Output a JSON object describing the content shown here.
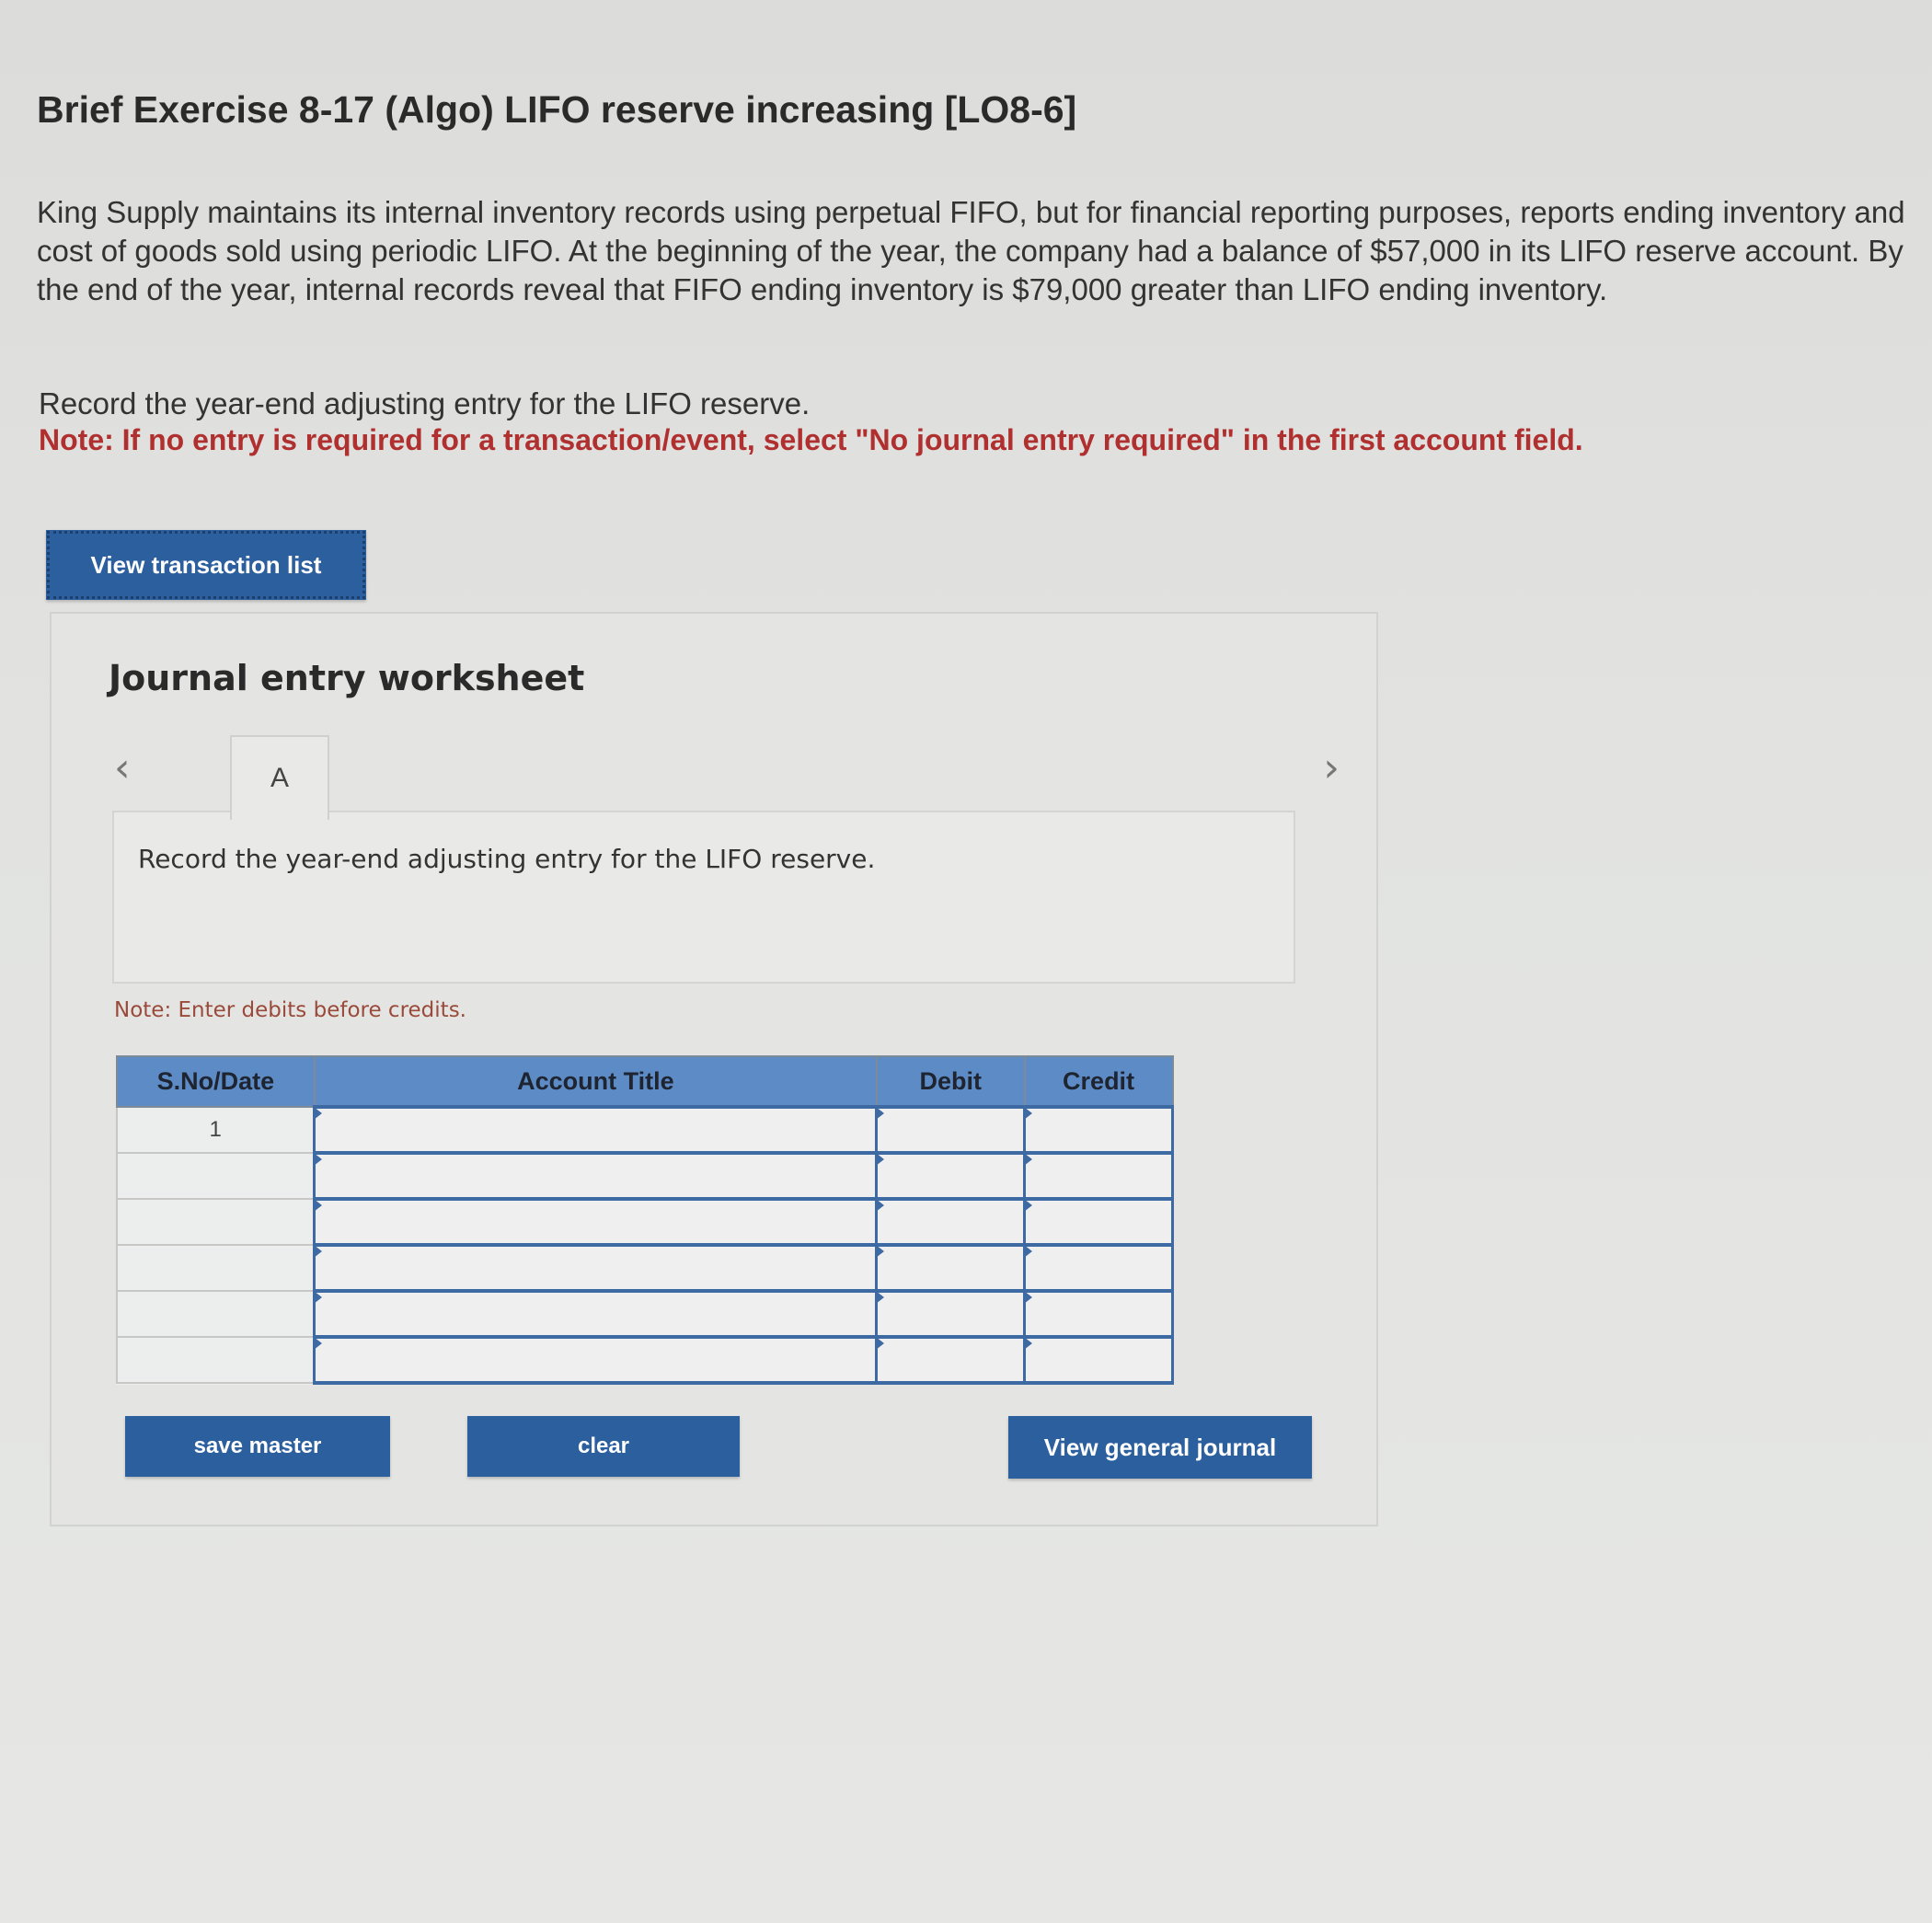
{
  "page": {
    "title": "Brief Exercise 8-17 (Algo) LIFO reserve increasing [LO8-6]",
    "intro": "King Supply maintains its internal inventory records using perpetual FIFO, but for financial reporting purposes, reports ending inventory and cost of goods sold using periodic LIFO. At the beginning of the year, the company had a balance of $57,000 in its LIFO reserve account. By the end of the year, internal records reveal that FIFO ending inventory is $79,000 greater than LIFO ending inventory.",
    "instruction": "Record the year-end adjusting entry for the LIFO reserve.",
    "note": "Note: If no entry is required for a transaction/event, select \"No journal entry required\" in the first account field."
  },
  "buttons": {
    "view_transaction_list": "View transaction list",
    "save_master": "save master",
    "clear": "clear",
    "view_general_journal": "View general journal"
  },
  "worksheet": {
    "title": "Journal entry worksheet",
    "active_tab": "A",
    "prompt": "Record the year-end adjusting entry for the LIFO reserve.",
    "note": "Note: Enter debits before credits.",
    "columns": [
      "S.No/Date",
      "Account Title",
      "Debit",
      "Credit"
    ],
    "rows": [
      {
        "sno": "1",
        "account": "",
        "debit": "",
        "credit": ""
      },
      {
        "sno": "",
        "account": "",
        "debit": "",
        "credit": ""
      },
      {
        "sno": "",
        "account": "",
        "debit": "",
        "credit": ""
      },
      {
        "sno": "",
        "account": "",
        "debit": "",
        "credit": ""
      },
      {
        "sno": "",
        "account": "",
        "debit": "",
        "credit": ""
      },
      {
        "sno": "",
        "account": "",
        "debit": "",
        "credit": ""
      }
    ]
  },
  "icons": {
    "prev": "chevron-left-icon",
    "next": "chevron-right-icon"
  },
  "colors": {
    "button_bg": "#2c5f9e",
    "header_bg": "#5d8bc6",
    "note_red": "#b03030"
  }
}
